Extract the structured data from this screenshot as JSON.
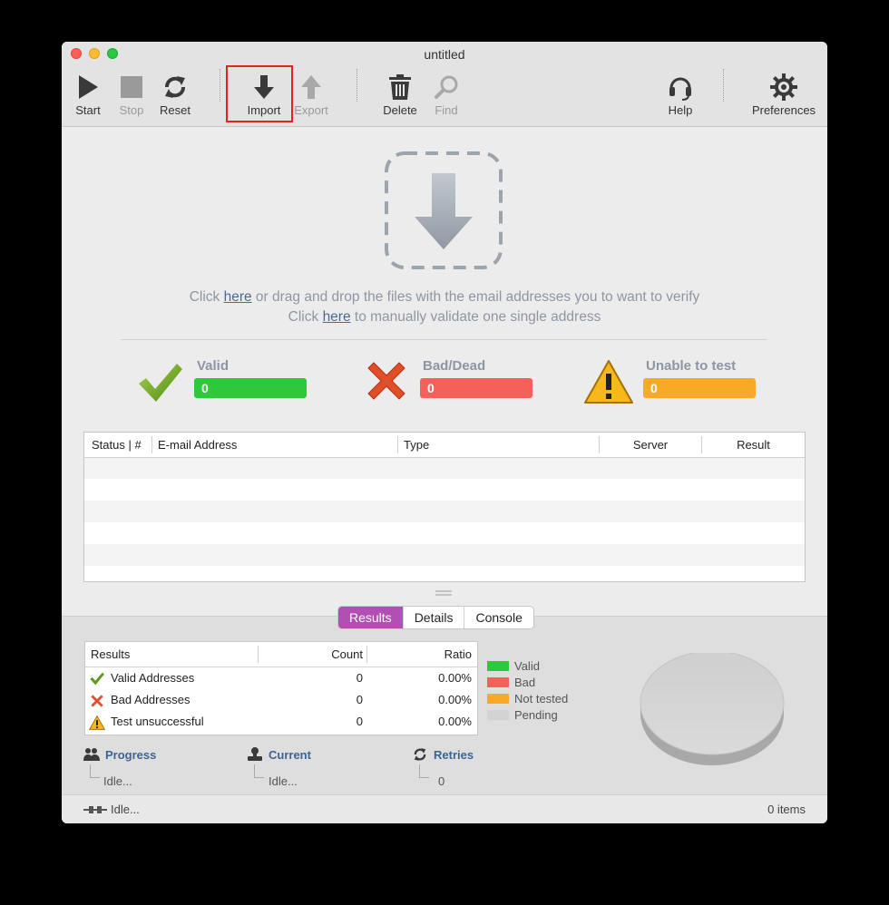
{
  "window": {
    "title": "untitled"
  },
  "toolbar": {
    "start": "Start",
    "stop": "Stop",
    "reset": "Reset",
    "import": "Import",
    "export": "Export",
    "delete": "Delete",
    "find": "Find",
    "help": "Help",
    "preferences": "Preferences"
  },
  "dropzone": {
    "line1_pre": "Click ",
    "line1_link": "here",
    "line1_post": " or drag and drop the files with the email addresses you to want to verify",
    "line2_pre": "Click ",
    "line2_link": "here",
    "line2_post": " to manually validate one single address"
  },
  "stats": {
    "valid": {
      "label": "Valid",
      "value": "0",
      "color": "#2ec93a"
    },
    "bad": {
      "label": "Bad/Dead",
      "value": "0",
      "color": "#f5605a"
    },
    "unable": {
      "label": "Unable to test",
      "value": "0",
      "color": "#f8a928"
    }
  },
  "email_table": {
    "columns": [
      "Status | #",
      "E-mail Address",
      "Type",
      "Server",
      "Result"
    ],
    "rows": []
  },
  "tabs": {
    "results": "Results",
    "details": "Details",
    "console": "Console",
    "active": "Results"
  },
  "results_table": {
    "columns": [
      "Results",
      "Count",
      "Ratio"
    ],
    "rows": [
      {
        "label": "Valid Addresses",
        "count": "0",
        "ratio": "0.00%",
        "icon": "check-icon"
      },
      {
        "label": "Bad Addresses",
        "count": "0",
        "ratio": "0.00%",
        "icon": "cross-icon"
      },
      {
        "label": "Test unsuccessful",
        "count": "0",
        "ratio": "0.00%",
        "icon": "warning-icon"
      }
    ]
  },
  "legend": [
    {
      "label": "Valid",
      "color": "#2ec93a"
    },
    {
      "label": "Bad",
      "color": "#f5605a"
    },
    {
      "label": "Not tested",
      "color": "#f8a928"
    },
    {
      "label": "Pending",
      "color": "#d3d3d3"
    }
  ],
  "progress": {
    "label": "Progress",
    "value": "Idle..."
  },
  "current": {
    "label": "Current",
    "value": "Idle..."
  },
  "retries": {
    "label": "Retries",
    "value": "0"
  },
  "statusbar": {
    "state": "Idle...",
    "items": "0 items"
  }
}
